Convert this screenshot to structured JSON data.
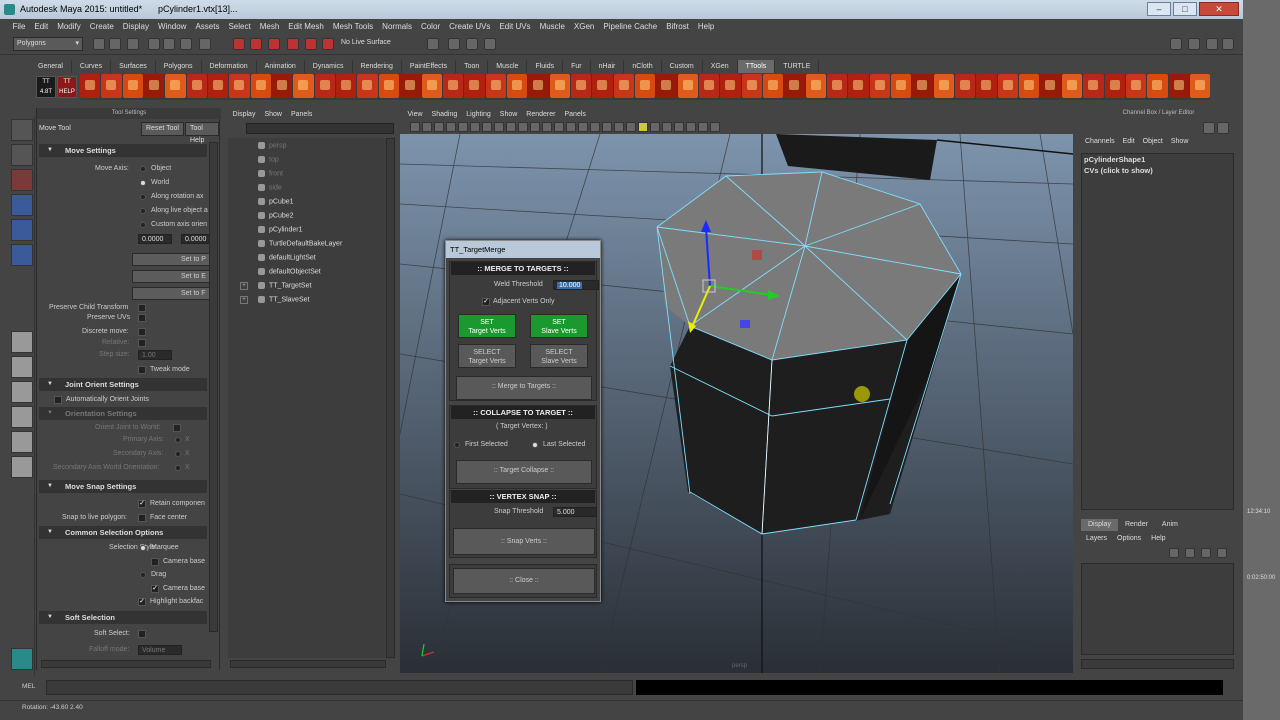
{
  "titlebar": {
    "app_title": "Autodesk Maya 2015: untitled*",
    "file": "pCylinder1.vtx[13]..."
  },
  "menubar": [
    "File",
    "Edit",
    "Modify",
    "Create",
    "Display",
    "Window",
    "Assets",
    "Select",
    "Mesh",
    "Edit Mesh",
    "Mesh Tools",
    "Normals",
    "Color",
    "Create UVs",
    "Edit UVs",
    "Muscle",
    "XGen",
    "Pipeline Cache",
    "Bifrost",
    "Help"
  ],
  "status_line": {
    "mode": "Polygons",
    "live_surface": "No Live Surface"
  },
  "shelf_tabs": [
    "General",
    "Curves",
    "Surfaces",
    "Polygons",
    "Deformation",
    "Animation",
    "Dynamics",
    "Rendering",
    "PaintEffects",
    "Toon",
    "Muscle",
    "Fluids",
    "Fur",
    "nHair",
    "nCloth",
    "Custom",
    "XGen",
    "TTools",
    "TURTLE"
  ],
  "shelf_active": "TTools",
  "shelf_badges": [
    "TT 4.8T",
    "TT HELP"
  ],
  "tool_settings": {
    "panel_title": "Tool Settings",
    "tool_name": "Move Tool",
    "reset_tool": "Reset Tool",
    "tool_help": "Tool Help",
    "move_settings": "Move Settings",
    "move_axis": "Move Axis:",
    "axis_options": [
      "Object",
      "World",
      "Along rotation ax",
      "Along live object a",
      "Custom axis orien"
    ],
    "custom_x": "0.0000",
    "custom_y": "0.0000",
    "set_buttons": [
      "Set to P",
      "Set to E",
      "Set to F"
    ],
    "preserve_child": "Preserve Child Transform",
    "preserve_uvs": "Preserve UVs",
    "discrete_move": "Discrete move:",
    "relative": "Relative:",
    "step_size": "Step size:",
    "step_value": "1.00",
    "tweak_mode": "Tweak mode",
    "joint_orient": "Joint Orient Settings",
    "auto_orient": "Automatically Orient Joints",
    "orientation_settings": "Orientation Settings",
    "orient_joint_world": "Orient Joint to World:",
    "primary_axis": "Primary Axis:",
    "secondary_axis": "Secondary Axis:",
    "secondary_world": "Secondary Axis World Orientation:",
    "axis_x": "X",
    "move_snap": "Move Snap Settings",
    "retain_component": "Retain componen",
    "snap_live_polygon": "Snap to live polygon:",
    "face_center": "Face center",
    "common_selection": "Common Selection Options",
    "selection_style": "Selection Style:",
    "marquee": "Marquee",
    "camera_based": "Camera base",
    "drag": "Drag",
    "camera_based2": "Camera base",
    "highlight_backface": "Highlight backfac",
    "soft_selection": "Soft Selection",
    "soft_select": "Soft Select:",
    "falloff_mode": "Falloff mode:",
    "falloff_value": "Volume"
  },
  "outliner": {
    "menu": [
      "Display",
      "Show",
      "Panels"
    ],
    "items": [
      {
        "label": "persp",
        "dim": true
      },
      {
        "label": "top",
        "dim": true
      },
      {
        "label": "front",
        "dim": true
      },
      {
        "label": "side",
        "dim": true
      },
      {
        "label": "pCube1",
        "dim": false
      },
      {
        "label": "pCube2",
        "dim": false
      },
      {
        "label": "pCylinder1",
        "dim": false
      },
      {
        "label": "TurtleDefaultBakeLayer",
        "dim": false
      },
      {
        "label": "defaultLightSet",
        "dim": false
      },
      {
        "label": "defaultObjectSet",
        "dim": false
      },
      {
        "label": "TT_TargetSet",
        "dim": false
      },
      {
        "label": "TT_SlaveSet",
        "dim": false
      }
    ]
  },
  "viewport": {
    "menu": [
      "View",
      "Shading",
      "Lighting",
      "Show",
      "Renderer",
      "Panels"
    ],
    "camera_label": "persp"
  },
  "tt_dialog": {
    "title": "TT_TargetMerge",
    "merge_header": ":: MERGE TO TARGETS ::",
    "weld_threshold_label": "Weld Threshold",
    "weld_threshold_value": "10.000",
    "adjacent_only": "Adjacent Verts Only",
    "set_label": "SET",
    "select_label": "SELECT",
    "target_verts": "Target Verts",
    "slave_verts": "Slave Verts",
    "merge_btn": ":: Merge to Targets ::",
    "collapse_header": ":: COLLAPSE TO TARGET ::",
    "target_vertex": "( Target Vertex: )",
    "first_selected": "First Selected",
    "last_selected": "Last Selected",
    "collapse_btn": ":: Target Collapse ::",
    "snap_header": ":: VERTEX SNAP ::",
    "snap_threshold_label": "Snap Threshold",
    "snap_threshold_value": "5.000",
    "snap_btn": ":: Snap Verts ::",
    "close_btn": ":: Close ::"
  },
  "channel_box": {
    "title": "Channel Box / Layer Editor",
    "menu": [
      "Channels",
      "Edit",
      "Object",
      "Show"
    ],
    "object": "pCylinderShape1",
    "cvs": "CVs (click to show)"
  },
  "layer_editor": {
    "tabs": [
      "Display",
      "Render",
      "Anim"
    ],
    "menu": [
      "Layers",
      "Options",
      "Help"
    ]
  },
  "command_line": {
    "label": "MEL"
  },
  "help_line": {
    "text": "Rotation: -43.60    2.40"
  },
  "right_strip": {
    "time1": "12:34:10",
    "time2": "0:02:50:00"
  }
}
